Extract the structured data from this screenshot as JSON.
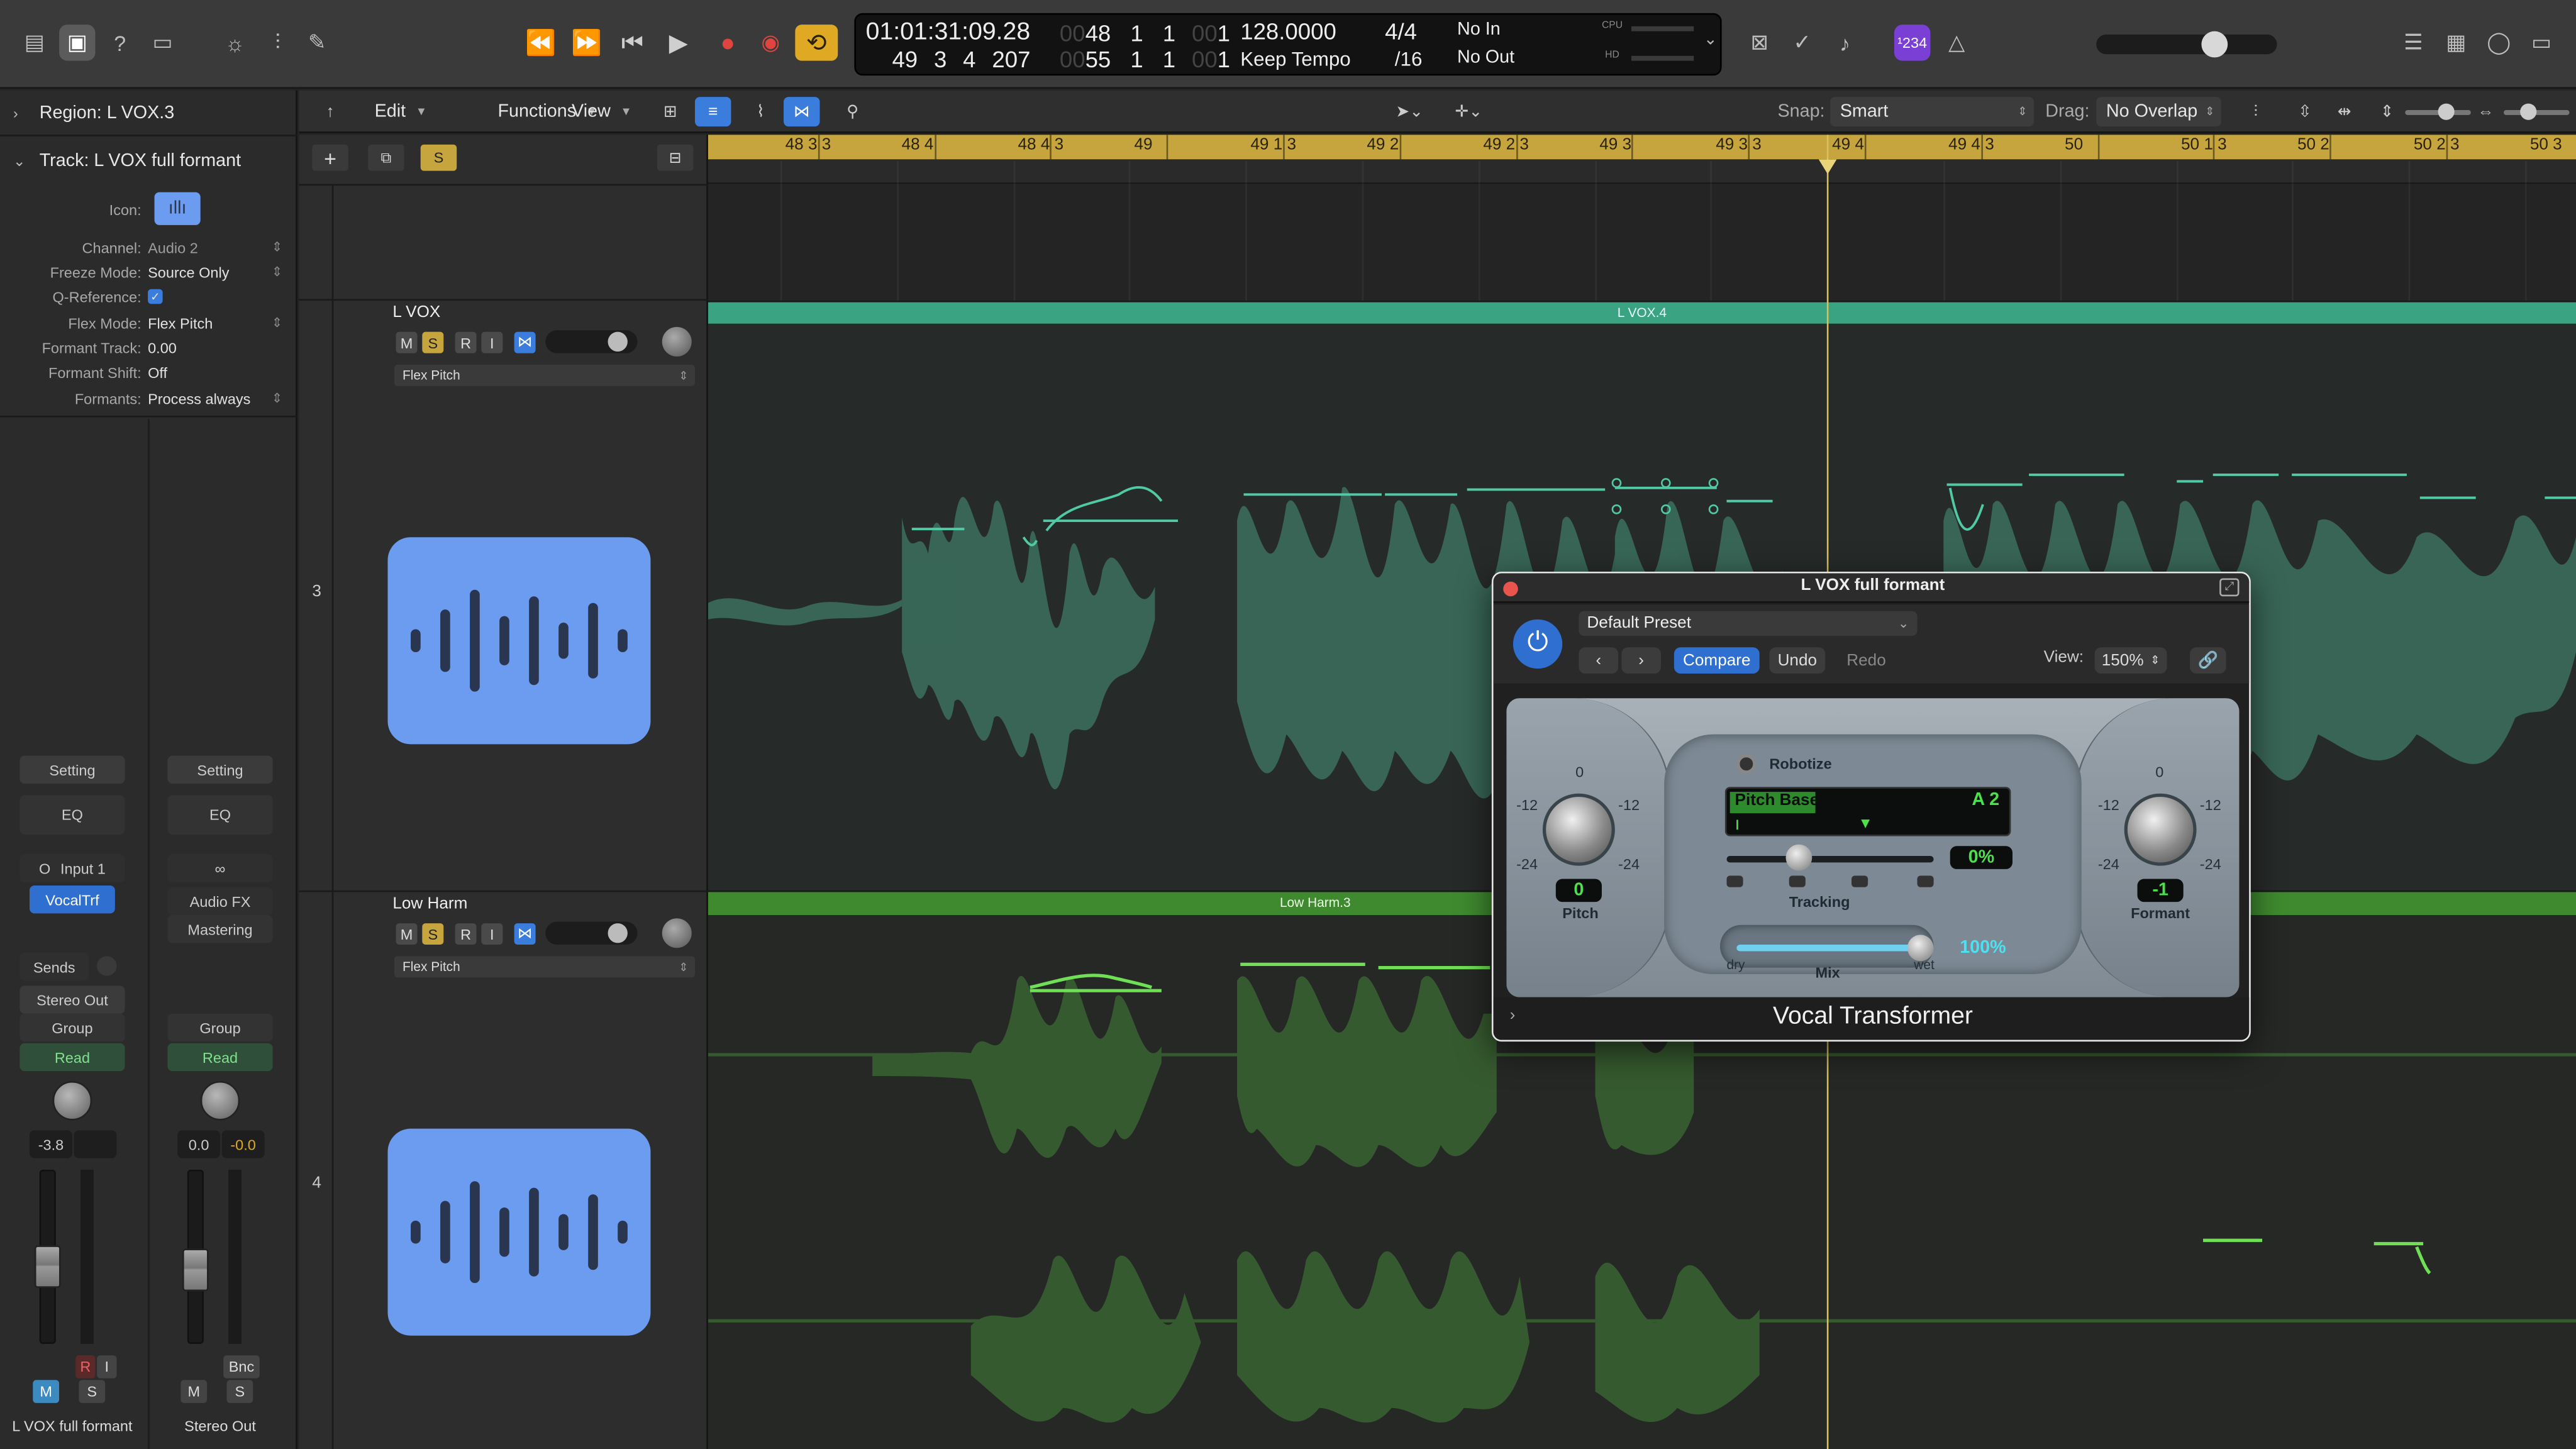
{
  "control_bar": {
    "lcd": {
      "time": "01:01:31:09.28",
      "bar_top": [
        "48",
        "1",
        "1",
        "1"
      ],
      "bar_top_dim": [
        "00",
        "00"
      ],
      "bar_bottom": [
        "49",
        "3",
        "4",
        "207"
      ],
      "bar_bottom2": [
        "55",
        "1",
        "1",
        "1"
      ],
      "bar_bottom2_dim": [
        "00",
        "00"
      ],
      "tempo": "128.0000",
      "tempo_mode": "Keep Tempo",
      "signature": "4/4",
      "division": "/16",
      "in": "No In",
      "out": "No Out",
      "cpu_label": "CPU",
      "hd_label": "HD"
    },
    "badge": "¹234"
  },
  "local_toolbar": {
    "edit": "Edit",
    "functions": "Functions",
    "view": "View",
    "snap_label": "Snap:",
    "snap_value": "Smart",
    "drag_label": "Drag:",
    "drag_value": "No Overlap"
  },
  "inspector": {
    "region": "Region: L VOX.3",
    "track": "Track: L VOX full formant",
    "rows": [
      {
        "k": "Channel:",
        "v": "Audio 2"
      },
      {
        "k": "Freeze Mode:",
        "v": "Source Only"
      },
      {
        "k": "Q-Reference:",
        "v": "✓"
      },
      {
        "k": "Flex Mode:",
        "v": "Flex Pitch"
      },
      {
        "k": "Formant Track:",
        "v": "0.00"
      },
      {
        "k": "Formant Shift:",
        "v": "Off"
      },
      {
        "k": "Formants:",
        "v": "Process always"
      }
    ],
    "icon_label": "Icon:",
    "strip_left": {
      "setting": "Setting",
      "eq": "EQ",
      "input": "Input 1",
      "plugin": "VocalTrf",
      "sends": "Sends",
      "output": "Stereo Out",
      "group": "Group",
      "auto": "Read",
      "vol": "-3.8",
      "name": "L VOX full formant",
      "m": "M",
      "s": "S",
      "rec": "R",
      "in": "I",
      "fader_level": 0.42
    },
    "strip_right": {
      "setting": "Setting",
      "eq": "EQ",
      "audio_fx": "Audio FX",
      "mastering": "Mastering",
      "group": "Group",
      "auto": "Read",
      "vol": "0.0",
      "pan": "-0.0",
      "bnc": "Bnc",
      "name": "Stereo Out",
      "m": "M",
      "s": "S",
      "fader_level": 0.4
    }
  },
  "tracks": [
    {
      "num": "3",
      "name": "L VOX",
      "flex": "Flex Pitch",
      "region": "L VOX.4",
      "m": "M",
      "s": "S",
      "r": "R",
      "i": "I"
    },
    {
      "num": "4",
      "name": "Low Harm",
      "flex": "Flex Pitch",
      "region": "Low Harm.3",
      "m": "M",
      "s": "S",
      "r": "R",
      "i": "I"
    }
  ],
  "ruler": [
    "48 3 3",
    "48 4",
    "48 4 3",
    "49",
    "49 1 3",
    "49 2",
    "49 2 3",
    "49 3",
    "49 3 3",
    "49 4",
    "49 4 3",
    "50",
    "50 1 3",
    "50 2",
    "50 2 3",
    "50 3"
  ],
  "plugin": {
    "title": "L VOX full formant",
    "preset": "Default Preset",
    "compare": "Compare",
    "undo": "Undo",
    "redo": "Redo",
    "view_label": "View:",
    "view_value": "150%",
    "name": "Vocal Transformer",
    "robotize": "Robotize",
    "pitch_base_label": "Pitch Base",
    "pitch_base_value": "A 2",
    "tracking_value": "0%",
    "tracking_label": "Tracking",
    "mix_value": "100%",
    "mix_label": "Mix",
    "dry": "dry",
    "wet": "wet",
    "pitch_value": "0",
    "pitch_label": "Pitch",
    "formant_value": "-1",
    "formant_label": "Formant",
    "scale_neg": "-12",
    "scale_pos": "-12",
    "scale_zero": "0",
    "scale_l": "-24",
    "scale_r": "-24"
  },
  "colors": {
    "accent": "#3b7ddd",
    "region_l": "#3aa381",
    "region_h": "#3f8a2f",
    "ruler": "#c6a53f",
    "record": "#e0443e",
    "cycle": "#e0a923"
  }
}
